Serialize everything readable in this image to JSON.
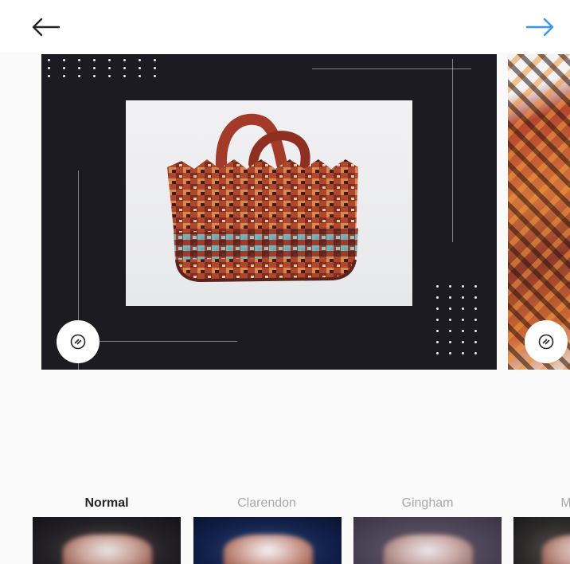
{
  "toolbar": {
    "back_icon": "arrow-left-icon",
    "next_icon": "arrow-right-icon",
    "next_color": "#3897f0"
  },
  "carousel": {
    "multi_select_icon": "multi-select-icon"
  },
  "filters": [
    {
      "label": "Normal",
      "active": true
    },
    {
      "label": "Clarendon",
      "active": false
    },
    {
      "label": "Gingham",
      "active": false
    },
    {
      "label": "M",
      "active": false
    }
  ]
}
